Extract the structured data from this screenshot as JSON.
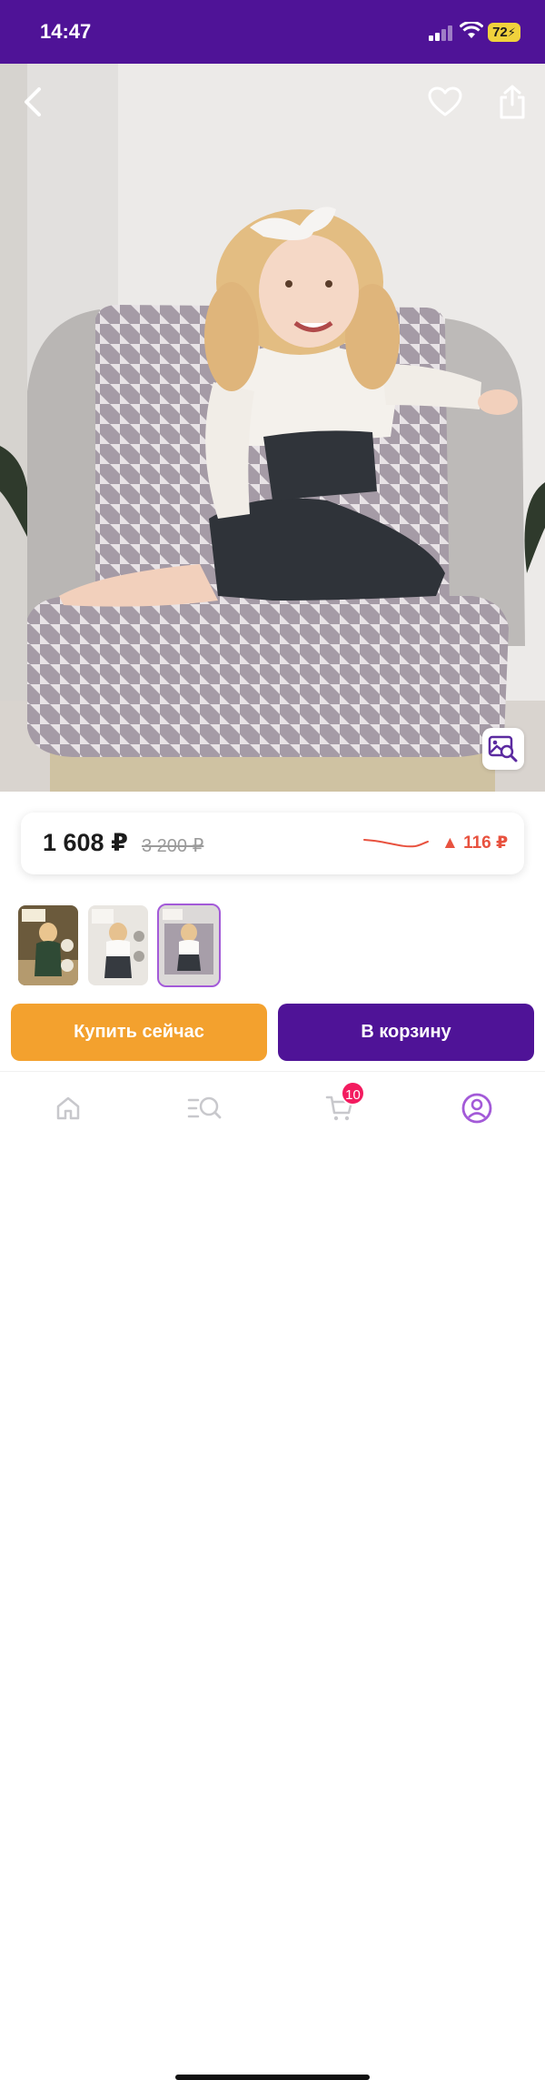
{
  "status_bar": {
    "time": "14:47",
    "battery": "72"
  },
  "header": {
    "back_icon": "chevron-left-icon",
    "favorite_icon": "heart-icon",
    "share_icon": "share-icon"
  },
  "product": {
    "price_current": "1 608 ₽",
    "price_old": "3 200 ₽",
    "price_change": "▲ 116 ₽",
    "price_change_color": "#e8523f",
    "thumbnails_count": 3,
    "selected_thumbnail": 3
  },
  "actions": {
    "buy_now": "Купить сейчас",
    "add_to_cart": "В корзину",
    "buy_color": "#f3a12e",
    "cart_color": "#4f1397"
  },
  "tabbar": {
    "cart_badge": "10",
    "items": [
      {
        "name": "home-icon"
      },
      {
        "name": "catalog-search-icon"
      },
      {
        "name": "cart-icon"
      },
      {
        "name": "profile-icon"
      }
    ],
    "active_color": "#a35ad8"
  },
  "theme": {
    "brand": "#4f1397"
  }
}
